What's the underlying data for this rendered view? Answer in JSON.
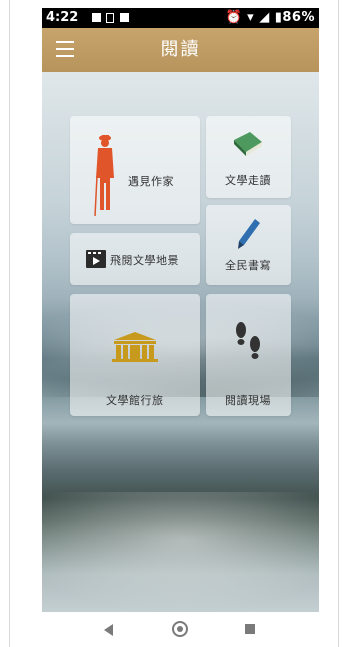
{
  "status_bar": {
    "time": "4:22",
    "indicators": "⏰ ▾ ◢ ▮86%"
  },
  "app_bar": {
    "menu_icon": "hamburger-icon",
    "title": "閱讀"
  },
  "tiles": [
    {
      "id": "meet-author",
      "label": "遇見作家",
      "icon": "author-figure-icon",
      "color": "#e0552a"
    },
    {
      "id": "literature-walk",
      "label": "文學走讀",
      "icon": "green-book-icon",
      "color": "#4e9a5e"
    },
    {
      "id": "fly-literature-map",
      "label": "飛閱文學地景",
      "icon": "video-play-icon",
      "color": "#2b2b2b"
    },
    {
      "id": "everyone-write",
      "label": "全民書寫",
      "icon": "pen-icon",
      "color": "#2f6fb0"
    },
    {
      "id": "literary-museum-tour",
      "label": "文學館行旅",
      "icon": "museum-building-icon",
      "color": "#c79a1e"
    },
    {
      "id": "reading-scene",
      "label": "閱讀現場",
      "icon": "footprints-icon",
      "color": "#333333"
    }
  ],
  "nav_bar": {
    "back": "back-triangle-icon",
    "home": "home-circle-icon",
    "recent": "recent-square-icon"
  }
}
